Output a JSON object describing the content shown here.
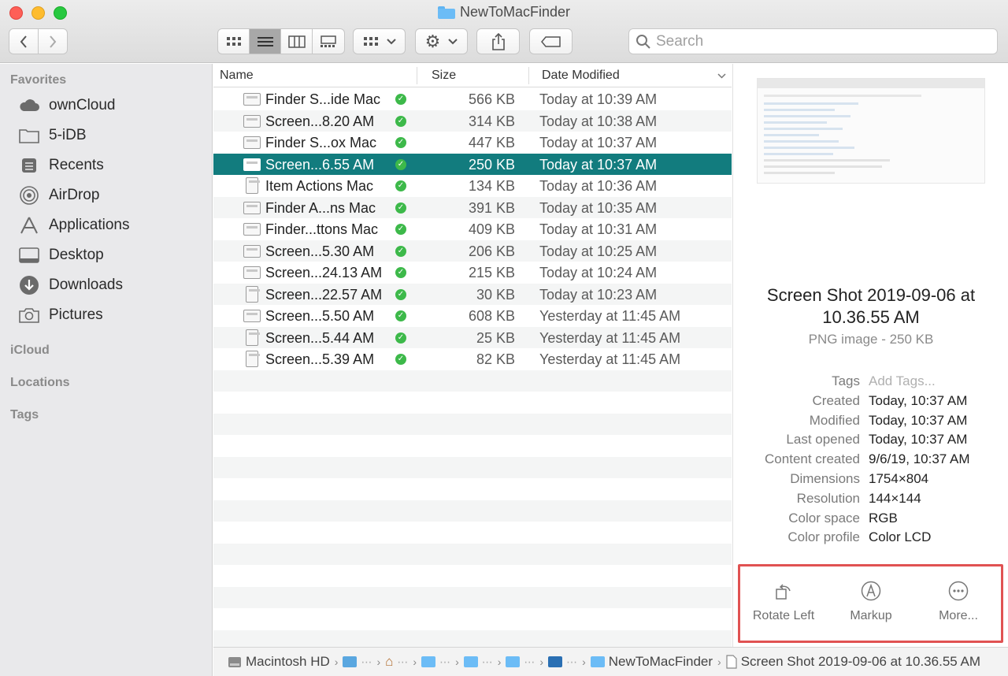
{
  "window": {
    "title": "NewToMacFinder",
    "traffic_lights": {
      "close": "#fe5f57",
      "minimize": "#febc2e",
      "zoom": "#28c840"
    }
  },
  "toolbar": {
    "search_placeholder": "Search",
    "view_modes": [
      "icon-view-icon",
      "list-view-icon",
      "column-view-icon",
      "gallery-view-icon"
    ],
    "active_view": "list"
  },
  "sidebar": {
    "favorites_header": "Favorites",
    "favorites": [
      {
        "label": "ownCloud",
        "icon": "cloud-icon"
      },
      {
        "label": "5-iDB",
        "icon": "folder-icon"
      },
      {
        "label": "Recents",
        "icon": "clock-icon"
      },
      {
        "label": "AirDrop",
        "icon": "airdrop-icon"
      },
      {
        "label": "Applications",
        "icon": "applications-icon"
      },
      {
        "label": "Desktop",
        "icon": "desktop-icon"
      },
      {
        "label": "Downloads",
        "icon": "downloads-icon"
      },
      {
        "label": "Pictures",
        "icon": "camera-icon"
      }
    ],
    "icloud_header": "iCloud",
    "locations_header": "Locations",
    "tags_header": "Tags"
  },
  "file_list": {
    "columns": {
      "name": "Name",
      "size": "Size",
      "date": "Date Modified"
    },
    "rows": [
      {
        "name": "Finder S...ide Mac",
        "size": "566 KB",
        "date": "Today at 10:39 AM"
      },
      {
        "name": "Screen...8.20 AM",
        "size": "314 KB",
        "date": "Today at 10:38 AM"
      },
      {
        "name": "Finder S...ox Mac",
        "size": "447 KB",
        "date": "Today at 10:37 AM"
      },
      {
        "name": "Screen...6.55 AM",
        "size": "250 KB",
        "date": "Today at 10:37 AM",
        "selected": true
      },
      {
        "name": "Item Actions Mac",
        "size": "134 KB",
        "date": "Today at 10:36 AM"
      },
      {
        "name": "Finder A...ns Mac",
        "size": "391 KB",
        "date": "Today at 10:35 AM"
      },
      {
        "name": "Finder...ttons Mac",
        "size": "409 KB",
        "date": "Today at 10:31 AM"
      },
      {
        "name": "Screen...5.30 AM",
        "size": "206 KB",
        "date": "Today at 10:25 AM"
      },
      {
        "name": "Screen...24.13 AM",
        "size": "215 KB",
        "date": "Today at 10:24 AM"
      },
      {
        "name": "Screen...22.57 AM",
        "size": "30 KB",
        "date": "Today at 10:23 AM"
      },
      {
        "name": "Screen...5.50 AM",
        "size": "608 KB",
        "date": "Yesterday at 11:45 AM"
      },
      {
        "name": "Screen...5.44 AM",
        "size": "25 KB",
        "date": "Yesterday at 11:45 AM"
      },
      {
        "name": "Screen...5.39 AM",
        "size": "82 KB",
        "date": "Yesterday at 11:45 AM"
      }
    ],
    "selection_color": "#127c7e",
    "synced_badge_color": "#3db94a"
  },
  "preview": {
    "title_line1": "Screen Shot 2019-09-06 at",
    "title_line2": "10.36.55 AM",
    "subtitle": "PNG image - 250 KB",
    "metadata": [
      {
        "key": "Tags",
        "value": "Add Tags...",
        "placeholder": true
      },
      {
        "key": "Created",
        "value": "Today, 10:37 AM"
      },
      {
        "key": "Modified",
        "value": "Today, 10:37 AM"
      },
      {
        "key": "Last opened",
        "value": "Today, 10:37 AM"
      },
      {
        "key": "Content created",
        "value": "9/6/19, 10:37 AM"
      },
      {
        "key": "Dimensions",
        "value": "1754×804"
      },
      {
        "key": "Resolution",
        "value": "144×144"
      },
      {
        "key": "Color space",
        "value": "RGB"
      },
      {
        "key": "Color profile",
        "value": "Color LCD"
      }
    ],
    "actions": [
      {
        "label": "Rotate Left",
        "icon": "rotate-left-icon"
      },
      {
        "label": "Markup",
        "icon": "markup-icon"
      },
      {
        "label": "More...",
        "icon": "more-icon"
      }
    ],
    "highlight_color": "#e05252"
  },
  "pathbar": {
    "root": "Macintosh HD",
    "current_folder": "NewToMacFinder",
    "file": "Screen Shot 2019-09-06 at 10.36.55 AM"
  }
}
